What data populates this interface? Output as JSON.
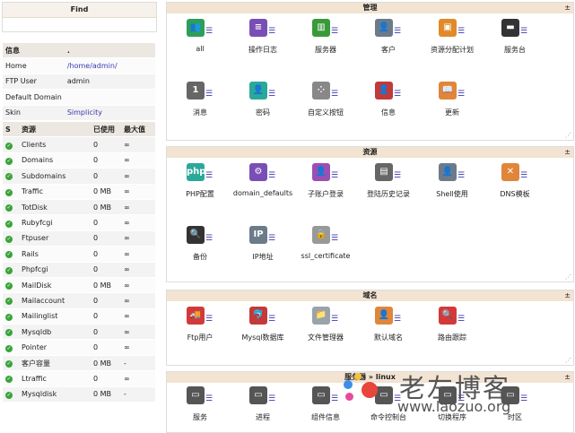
{
  "find": {
    "title": "Find"
  },
  "info": {
    "header": {
      "label": "信息",
      "value": "."
    },
    "rows": [
      {
        "label": "Home",
        "value": "/home/admin/"
      },
      {
        "label": "FTP User",
        "value": "admin"
      },
      {
        "label": "Default Domain",
        "value": ""
      },
      {
        "label": "Skin",
        "value": "Simplicity"
      }
    ]
  },
  "resources": {
    "headers": [
      "S",
      "资源",
      "已使用",
      "最大值"
    ],
    "rows": [
      {
        "name": "Clients",
        "used": "0",
        "max": "∞"
      },
      {
        "name": "Domains",
        "used": "0",
        "max": "∞"
      },
      {
        "name": "Subdomains",
        "used": "0",
        "max": "∞"
      },
      {
        "name": "Traffic",
        "used": "0 MB",
        "max": "∞"
      },
      {
        "name": "TotDisk",
        "used": "0 MB",
        "max": "∞"
      },
      {
        "name": "Rubyfcgi",
        "used": "0",
        "max": "∞"
      },
      {
        "name": "Ftpuser",
        "used": "0",
        "max": "∞"
      },
      {
        "name": "Rails",
        "used": "0",
        "max": "∞"
      },
      {
        "name": "Phpfcgi",
        "used": "0",
        "max": "∞"
      },
      {
        "name": "MailDisk",
        "used": "0 MB",
        "max": "∞"
      },
      {
        "name": "Mailaccount",
        "used": "0",
        "max": "∞"
      },
      {
        "name": "Mailinglist",
        "used": "0",
        "max": "∞"
      },
      {
        "name": "Mysqldb",
        "used": "0",
        "max": "∞"
      },
      {
        "name": "Pointer",
        "used": "0",
        "max": "∞"
      },
      {
        "name": "客户容量",
        "used": "0 MB",
        "max": "-"
      },
      {
        "name": "Ltraffic",
        "used": "0",
        "max": "∞"
      },
      {
        "name": "Mysqldisk",
        "used": "0 MB",
        "max": "-"
      }
    ]
  },
  "panels": {
    "manage": {
      "title": "管理",
      "toggle": "±",
      "items": [
        {
          "label": "all",
          "icon": "users-icon",
          "glyph": "👥",
          "color": "#2e9e5b"
        },
        {
          "label": "操作日志",
          "icon": "log-icon",
          "glyph": "≡",
          "color": "#7a4fb5"
        },
        {
          "label": "服务器",
          "icon": "server-icon",
          "glyph": "▥",
          "color": "#3a9a3a"
        },
        {
          "label": "客户",
          "icon": "client-icon",
          "glyph": "👤",
          "color": "#6b7b8a"
        },
        {
          "label": "资源分配计划",
          "icon": "plan-icon",
          "glyph": "▣",
          "color": "#e08a2a"
        },
        {
          "label": "服务台",
          "icon": "ticket-icon",
          "glyph": "▬",
          "color": "#333333"
        },
        {
          "label": "消息",
          "icon": "message-icon",
          "glyph": "1",
          "color": "#666666"
        },
        {
          "label": "密码",
          "icon": "password-icon",
          "glyph": "👤",
          "color": "#2aa89a"
        },
        {
          "label": "自定义按钮",
          "icon": "custom-button-icon",
          "glyph": "⁘",
          "color": "#888888"
        },
        {
          "label": "信息",
          "icon": "info-icon",
          "glyph": "👤",
          "color": "#c23a3a"
        },
        {
          "label": "更新",
          "icon": "update-icon",
          "glyph": "📖",
          "color": "#e0863a"
        }
      ]
    },
    "resource": {
      "title": "资源",
      "toggle": "±",
      "items": [
        {
          "label": "PHP配置",
          "icon": "php-icon",
          "glyph": "php",
          "color": "#2aa89a"
        },
        {
          "label": "domain_defaults",
          "icon": "domain-defaults-icon",
          "glyph": "⚙",
          "color": "#7a4fb5"
        },
        {
          "label": "子账户登录",
          "icon": "subaccount-icon",
          "glyph": "👤",
          "color": "#9a4fb5"
        },
        {
          "label": "登陆历史记录",
          "icon": "login-history-icon",
          "glyph": "▤",
          "color": "#666666"
        },
        {
          "label": "Shell使用",
          "icon": "shell-icon",
          "glyph": "👤",
          "color": "#6b7b8a"
        },
        {
          "label": "DNS模板",
          "icon": "dns-icon",
          "glyph": "✕",
          "color": "#e0863a"
        },
        {
          "label": "备份",
          "icon": "backup-icon",
          "glyph": "🔍",
          "color": "#333333"
        },
        {
          "label": "IP地址",
          "icon": "ip-icon",
          "glyph": "IP",
          "color": "#6b7b8a"
        },
        {
          "label": "ssl_certificate",
          "icon": "ssl-icon",
          "glyph": "🔒",
          "color": "#999999"
        }
      ]
    },
    "domain": {
      "title": "域名",
      "toggle": "±",
      "items": [
        {
          "label": "Ftp用户",
          "icon": "ftp-icon",
          "glyph": "🚚",
          "color": "#d23a3a"
        },
        {
          "label": "Mysql数据库",
          "icon": "mysql-icon",
          "glyph": "🐬",
          "color": "#c23a3a"
        },
        {
          "label": "文件管理器",
          "icon": "folder-icon",
          "glyph": "📁",
          "color": "#9aa3ab"
        },
        {
          "label": "默认域名",
          "icon": "default-domain-icon",
          "glyph": "👤",
          "color": "#e0863a"
        },
        {
          "label": "路由跟踪",
          "icon": "traceroute-icon",
          "glyph": "🔍",
          "color": "#d23a3a"
        }
      ]
    },
    "server": {
      "title_prefix": "服务器",
      "title_sep": "»",
      "title_os": "linux",
      "toggle": "±",
      "items": [
        {
          "label": "服务",
          "icon": "service-icon",
          "glyph": "▭",
          "color": "#555555"
        },
        {
          "label": "进程",
          "icon": "process-icon",
          "glyph": "▭",
          "color": "#555555"
        },
        {
          "label": "组件信息",
          "icon": "component-icon",
          "glyph": "▭",
          "color": "#555555"
        },
        {
          "label": "命令控制台",
          "icon": "console-icon",
          "glyph": "▭",
          "color": "#555555"
        },
        {
          "label": "切换程序",
          "icon": "switch-icon",
          "glyph": "▭",
          "color": "#555555"
        },
        {
          "label": "时区",
          "icon": "timezone-icon",
          "glyph": "▭",
          "color": "#555555"
        }
      ]
    }
  },
  "watermark": {
    "cn": "老左博客",
    "url": "www.laozuo.org"
  }
}
